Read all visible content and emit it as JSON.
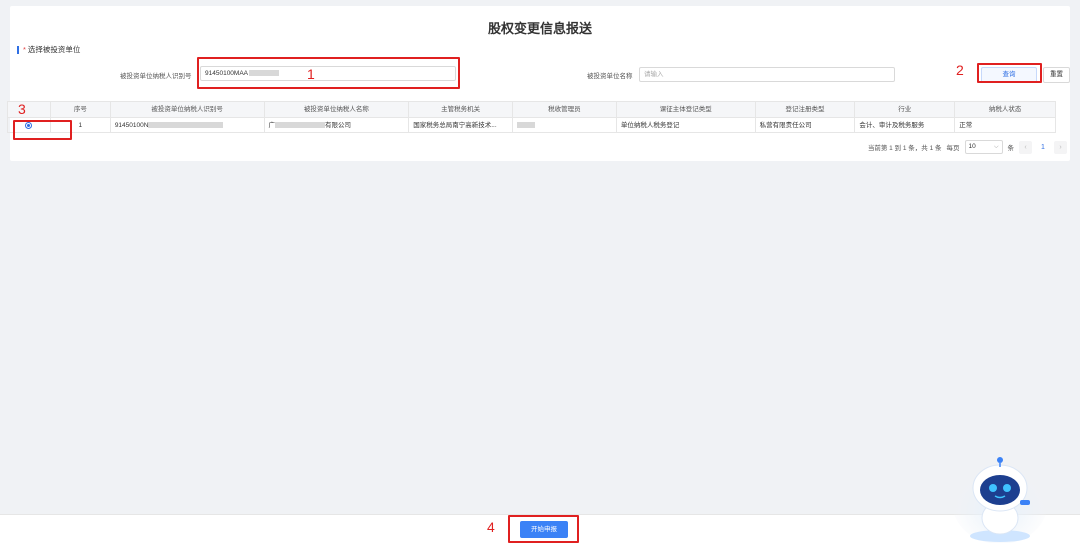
{
  "page": {
    "title": "股权变更信息报送"
  },
  "section": {
    "required_mark": "*",
    "label": "选择被投资单位"
  },
  "search": {
    "taxid_label": "被投资单位纳税人识别号",
    "taxid_value": "91450100MAA",
    "name_label": "被投资单位名称",
    "name_placeholder": "请输入",
    "query_label": "查询",
    "reset_label": "重置"
  },
  "table": {
    "headers": [
      "",
      "序号",
      "被投资单位纳税人识别号",
      "被投资单位纳税人名称",
      "主管税务机关",
      "税收管理员",
      "课征主体登记类型",
      "登记注册类型",
      "行业",
      "纳税人状态"
    ],
    "rows": [
      {
        "index": "1",
        "taxid": "91450100N",
        "name_prefix": "广",
        "name_suffix": "有限公司",
        "tax_authority": "国家税务总局南宁高新技术...",
        "manager": "",
        "reg_subject_type": "单位纳税人税务登记",
        "reg_type": "私营有限责任公司",
        "industry": "会计、审计及税务服务",
        "status": "正常"
      }
    ]
  },
  "pager": {
    "summary": "当前第 1 到 1 条，共 1 条",
    "per_page_label": "每页",
    "page_size": "10",
    "unit": "条",
    "current_page": "1",
    "prev_icon": "chevron-left-icon",
    "next_icon": "chevron-right-icon"
  },
  "annotations": {
    "one": "1",
    "two": "2",
    "three": "3",
    "four": "4"
  },
  "footer": {
    "submit_label": "开始申报"
  },
  "colors": {
    "accent": "#2f6fe4",
    "annotation": "#e02020",
    "primary_button": "#3b82f6"
  }
}
